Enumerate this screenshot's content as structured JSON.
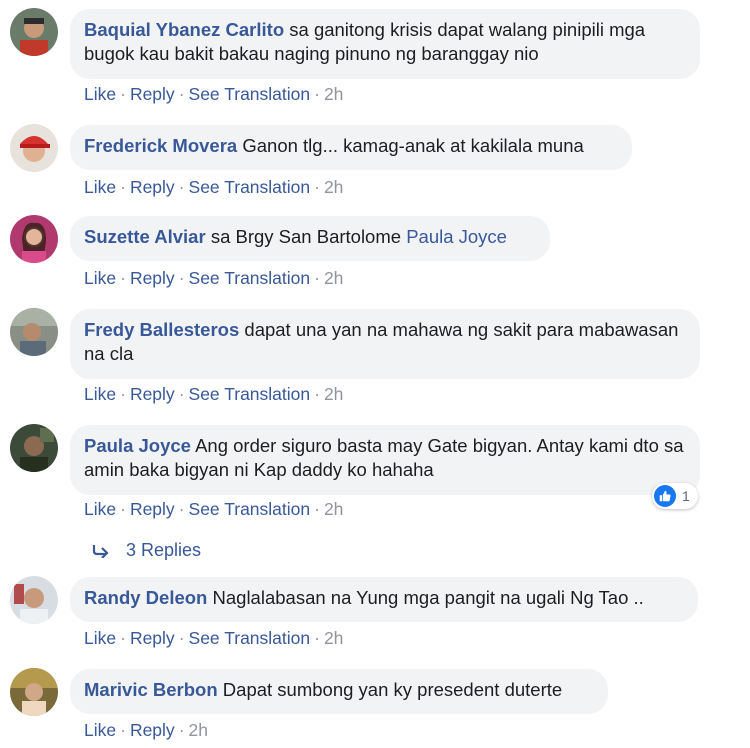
{
  "actions": {
    "like": "Like",
    "reply": "Reply",
    "see_translation": "See Translation",
    "separator": "·"
  },
  "colors": {
    "author": "#385898",
    "bubble_bg": "#f2f3f5",
    "meta_gray": "#90949c",
    "like_blue": "#1877f2"
  },
  "comments": [
    {
      "author": "Baquial Ybanez Carlito",
      "text": "sa ganitong krisis dapat walang pinipili mga bugok kau bakit bakau naging pinuno ng baranggay nio",
      "time": "2h"
    },
    {
      "author": "Frederick Movera",
      "text": "Ganon tlg... kamag-anak at kakilala muna",
      "time": "2h"
    },
    {
      "author": "Suzette Alviar",
      "text": "sa Brgy San Bartolome",
      "mention": "Paula Joyce",
      "time": "2h"
    },
    {
      "author": "Fredy Ballesteros",
      "text": "dapat una yan na mahawa ng sakit para mabawasan na cla",
      "time": "2h"
    },
    {
      "author": "Paula Joyce",
      "text": "Ang order siguro basta may Gate bigyan. Antay kami dto sa amin baka bigyan ni Kap daddy ko hahaha",
      "time": "2h",
      "reaction_icon": "like-icon",
      "reaction_count": "1",
      "replies_label": "3 Replies"
    },
    {
      "author": "Randy Deleon",
      "text": "Naglalabasan na Yung mga pangit na ugali Ng Tao ..",
      "time": "2h"
    },
    {
      "author": "Marivic Berbon",
      "text": "Dapat sumbong yan ky presedent duterte",
      "time": "2h"
    }
  ]
}
